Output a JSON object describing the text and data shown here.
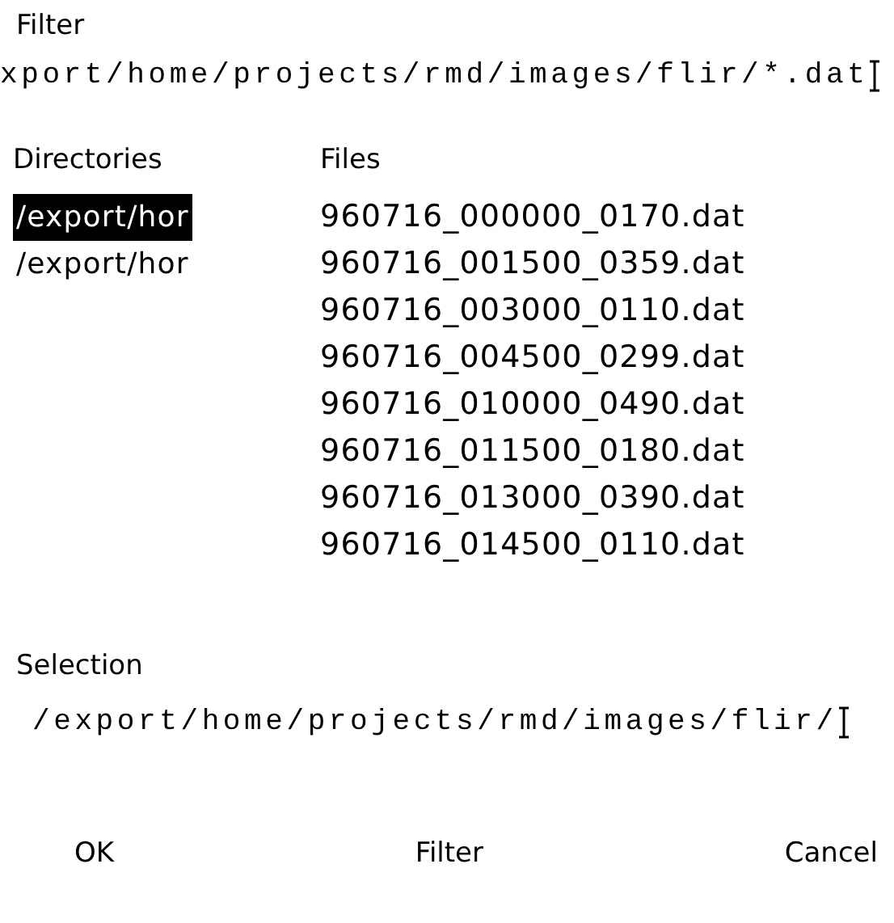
{
  "filter": {
    "label": "Filter",
    "value": "xport/home/projects/rmd/images/flir/*.dat"
  },
  "directories": {
    "label": "Directories",
    "items": [
      {
        "name": "/export/hor",
        "selected": true
      },
      {
        "name": "/export/hor",
        "selected": false
      }
    ]
  },
  "files": {
    "label": "Files",
    "items": [
      {
        "name": "960716_000000_0170.dat",
        "selected": false
      },
      {
        "name": "960716_001500_0359.dat",
        "selected": false
      },
      {
        "name": "960716_003000_0110.dat",
        "selected": false
      },
      {
        "name": "960716_004500_0299.dat",
        "selected": false
      },
      {
        "name": "960716_010000_0490.dat",
        "selected": false
      },
      {
        "name": "960716_011500_0180.dat",
        "selected": false
      },
      {
        "name": "960716_013000_0390.dat",
        "selected": false
      },
      {
        "name": "960716_014500_0110.dat",
        "selected": false
      }
    ]
  },
  "selection": {
    "label": "Selection",
    "value": "/export/home/projects/rmd/images/flir/"
  },
  "buttons": [
    "OK",
    "Filter",
    "Cancel"
  ]
}
